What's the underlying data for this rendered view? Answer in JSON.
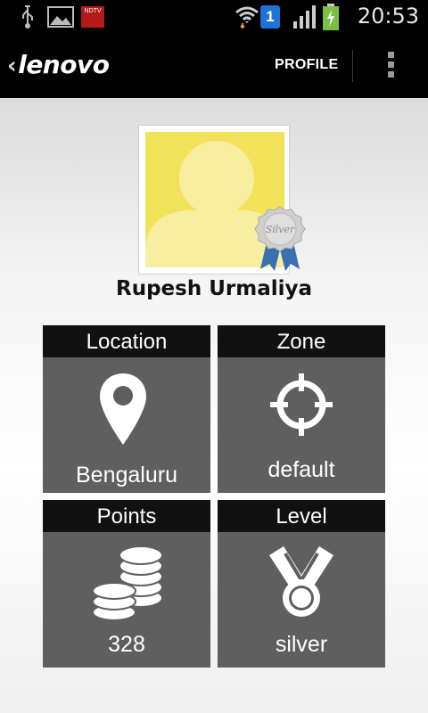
{
  "status_bar": {
    "time": "20:53",
    "notification_app_label": "NDTV",
    "sim_slot": "1",
    "icons": [
      "usb-icon",
      "image-icon",
      "ndtv-app-icon",
      "wifi-icon",
      "sim-icon",
      "signal-icon",
      "battery-icon"
    ]
  },
  "action_bar": {
    "logo": "lenovo",
    "title": "PROFILE",
    "overflow_icon": "overflow-menu-icon"
  },
  "profile": {
    "name": "Rupesh Urmaliya",
    "badge_label": "Silver",
    "avatar_bg": "#f2e25a"
  },
  "tiles": [
    {
      "header": "Location",
      "value": "Bengaluru",
      "icon": "map-pin-icon"
    },
    {
      "header": "Zone",
      "value": "default",
      "icon": "crosshair-icon"
    },
    {
      "header": "Points",
      "value": "328",
      "icon": "coins-icon"
    },
    {
      "header": "Level",
      "value": "silver",
      "icon": "medal-icon"
    }
  ],
  "colors": {
    "bar": "#000000",
    "tile_body": "#5f5f5f",
    "tile_header": "#111111"
  }
}
